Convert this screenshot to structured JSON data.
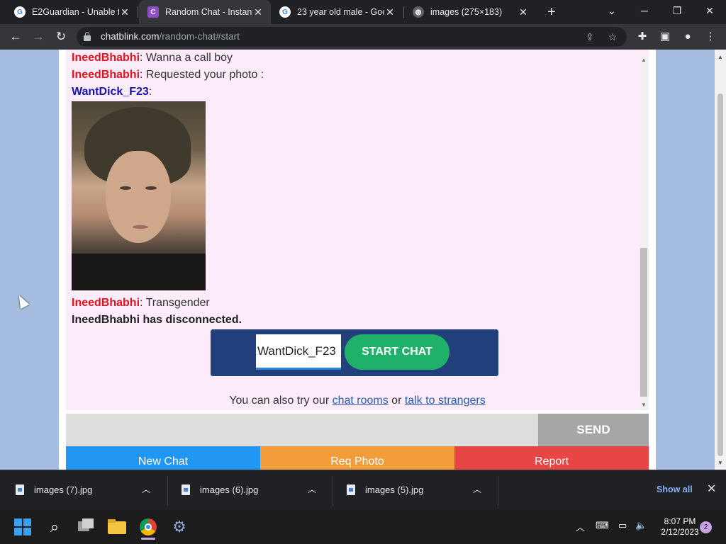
{
  "browser": {
    "tabs": [
      {
        "title": "E2Guardian - Unable to",
        "favicon": "google-icon",
        "active": false
      },
      {
        "title": "Random Chat - Instant",
        "favicon": "chatblink-icon",
        "active": true
      },
      {
        "title": "23 year old male - Goo",
        "favicon": "google-icon",
        "active": false
      },
      {
        "title": "images (275×183)",
        "favicon": "globe-icon",
        "active": false
      }
    ],
    "url_domain": "chatblink.com",
    "url_path": "/random-chat#start",
    "colors": {
      "chrome_dark": "#202124",
      "chrome_toolbar": "#35363a"
    }
  },
  "chat": {
    "messages": [
      {
        "user": "IneedBhabhi",
        "sep": ":",
        "text": " Wanna a call boy"
      },
      {
        "user": "IneedBhabhi",
        "sep": ":",
        "text": " Requested your photo :"
      },
      {
        "user": "WantDick_F23",
        "sep": ":",
        "text": ""
      },
      {
        "user": "IneedBhabhi",
        "sep": ":",
        "text": " Transgender"
      }
    ],
    "system_message": "IneedBhabhi has disconnected.",
    "name_value": "WantDick_F23",
    "start_label": "START CHAT",
    "try_prefix": "You can also try our ",
    "chat_rooms_link": "chat rooms",
    "try_middle": " or ",
    "strangers_link": "talk to strangers",
    "send_label": "SEND",
    "actions": {
      "new_chat": "New Chat",
      "req_photo": "Req Photo",
      "report": "Report"
    },
    "colors": {
      "stranger": "#e0141e",
      "you": "#1414b4",
      "chat_bg": "#fcebf8",
      "start_bar": "#22417c",
      "start_button": "#1fb16a",
      "new_chat": "#2196f3",
      "req_photo": "#f39c3c",
      "report": "#e84545",
      "page_bg": "#a5bde0"
    }
  },
  "downloads": {
    "items": [
      "images (7).jpg",
      "images (6).jpg",
      "images (5).jpg"
    ],
    "show_all": "Show all"
  },
  "taskbar": {
    "time": "8:07 PM",
    "date": "2/12/2023",
    "notification_count": "2"
  }
}
